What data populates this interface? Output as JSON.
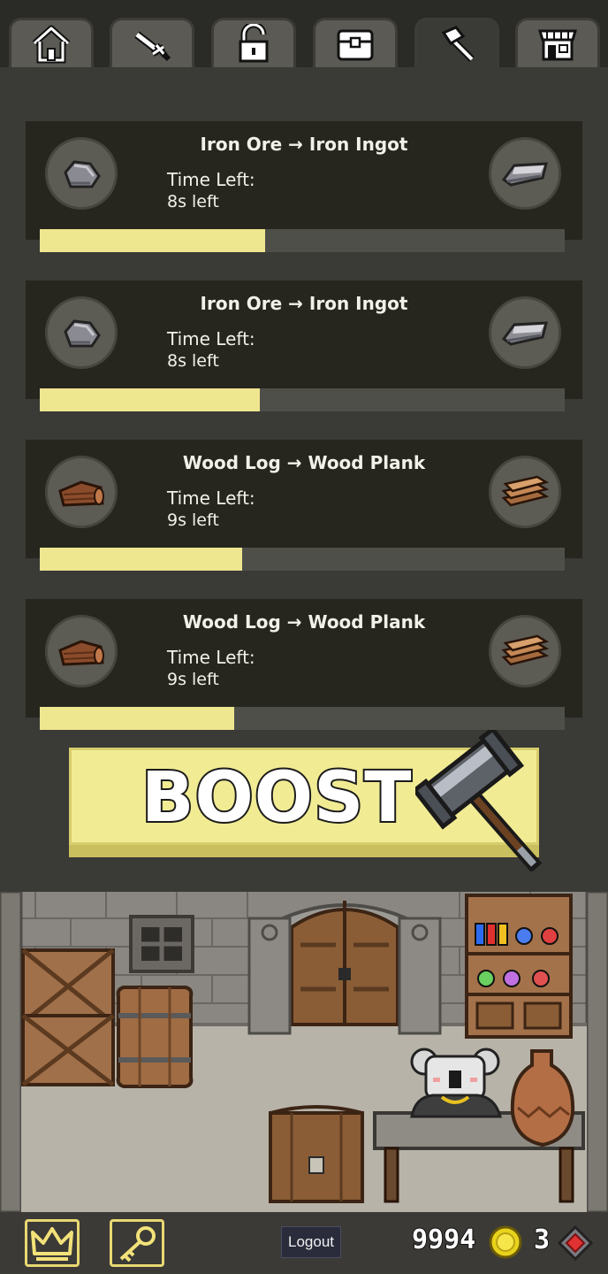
{
  "tabs": [
    {
      "name": "home",
      "icon": "home-icon",
      "active": false
    },
    {
      "name": "sword",
      "icon": "sword-icon",
      "active": false
    },
    {
      "name": "unlock",
      "icon": "unlock-icon",
      "active": false
    },
    {
      "name": "chest",
      "icon": "chest-icon",
      "active": false
    },
    {
      "name": "hammer",
      "icon": "hammer-icon",
      "active": true
    },
    {
      "name": "shop",
      "icon": "shop-icon",
      "active": false
    }
  ],
  "jobs": [
    {
      "title": "Iron Ore → Iron Ingot",
      "time_label": "Time Left:",
      "time_value": "8s left",
      "input_icon": "iron-ore-icon",
      "output_icon": "iron-ingot-icon",
      "progress": 0.43
    },
    {
      "title": "Iron Ore → Iron Ingot",
      "time_label": "Time Left:",
      "time_value": "8s left",
      "input_icon": "iron-ore-icon",
      "output_icon": "iron-ingot-icon",
      "progress": 0.42
    },
    {
      "title": "Wood Log → Wood Plank",
      "time_label": "Time Left:",
      "time_value": "9s left",
      "input_icon": "wood-log-icon",
      "output_icon": "wood-plank-icon",
      "progress": 0.385
    },
    {
      "title": "Wood Log → Wood Plank",
      "time_label": "Time Left:",
      "time_value": "9s left",
      "input_icon": "wood-log-icon",
      "output_icon": "wood-plank-icon",
      "progress": 0.37
    }
  ],
  "boost": {
    "label": "BOOST",
    "icon": "hammer-icon"
  },
  "bottom": {
    "crown_icon": "crown-icon",
    "key_icon": "key-icon",
    "logout_label": "Logout",
    "coins": "9994",
    "coin_icon": "gold-coin-icon",
    "gems": "3",
    "gem_icon": "red-gem-icon"
  },
  "colors": {
    "progress_fill": "#efe690",
    "boost_bg": "#f1eb94",
    "card_bg": "#26261f",
    "accent_border": "#e9d873"
  }
}
